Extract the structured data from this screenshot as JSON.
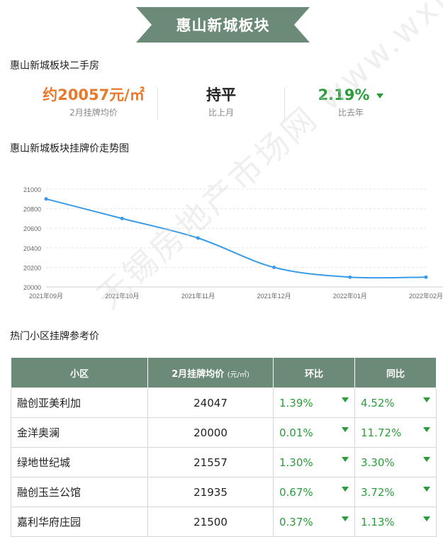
{
  "banner": {
    "title": "惠山新城板块"
  },
  "summary": {
    "heading": "惠山新城板块二手房",
    "stats": [
      {
        "value": "约20057元/㎡",
        "label": "2月挂牌均价",
        "color": "#e8792a"
      },
      {
        "value": "持平",
        "label": "比上月",
        "color": "#222222"
      },
      {
        "value": "2.19%",
        "label": "比去年",
        "color": "#2a9d3a",
        "trend": "down"
      }
    ]
  },
  "chart_heading": "惠山新城板块挂牌价走势图",
  "chart_data": {
    "type": "line",
    "x": [
      "2021年09月",
      "2021年10月",
      "2021年11月",
      "2021年12月",
      "2022年01月",
      "2022年02月"
    ],
    "series": [
      {
        "values": [
          20900,
          20700,
          20500,
          20200,
          20100,
          20100
        ]
      }
    ],
    "ylim": [
      20000,
      21000
    ],
    "yticks": [
      20000,
      20200,
      20400,
      20600,
      20800,
      21000
    ],
    "grid": true,
    "line_color": "#3a9be8"
  },
  "table_heading": "热门小区挂牌参考价",
  "table": {
    "headers": {
      "name": "小区",
      "price": "2月挂牌均价",
      "price_unit": "(元/㎡)",
      "mom": "环比",
      "yoy": "同比"
    },
    "rows": [
      {
        "name": "融创亚美利加",
        "price": "24047",
        "mom": "1.39%",
        "yoy": "4.52%"
      },
      {
        "name": "金洋奥澜",
        "price": "20000",
        "mom": "0.01%",
        "yoy": "11.72%"
      },
      {
        "name": "绿地世纪城",
        "price": "21557",
        "mom": "1.30%",
        "yoy": "3.30%"
      },
      {
        "name": "融创玉兰公馆",
        "price": "21935",
        "mom": "0.67%",
        "yoy": "3.72%"
      },
      {
        "name": "嘉利华府庄园",
        "price": "21500",
        "mom": "0.37%",
        "yoy": "1.13%"
      }
    ]
  },
  "watermark": "无锡房地产市场网 www.wxhouse.com"
}
